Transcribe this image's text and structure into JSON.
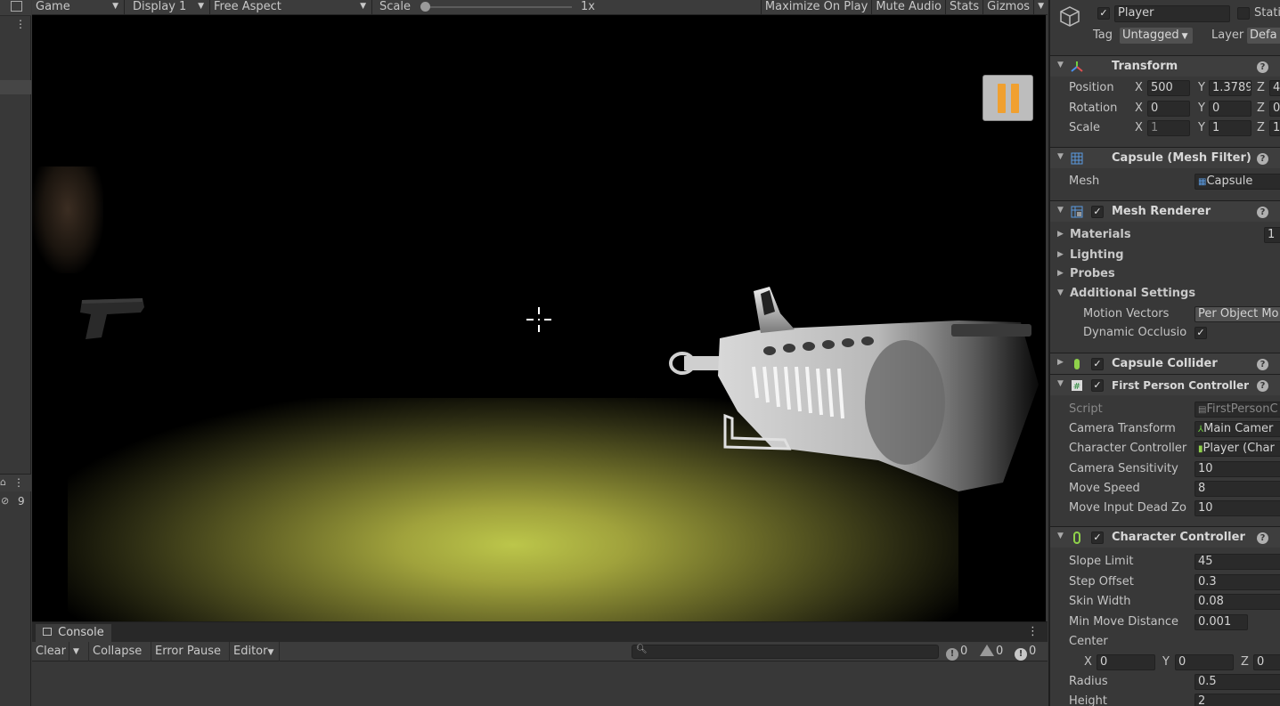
{
  "game_toolbar": {
    "view_label": "Game",
    "display_label": "Display 1",
    "aspect_label": "Free Aspect",
    "scale_label": "Scale",
    "scale_value": "1x",
    "scale_slider_fraction": 0.0,
    "maximize_label": "Maximize On Play",
    "mute_label": "Mute Audio",
    "stats_label": "Stats",
    "gizmos_label": "Gizmos"
  },
  "left_strip": {
    "layer_count": "9"
  },
  "console": {
    "tab_label": "Console",
    "clear_label": "Clear",
    "collapse_label": "Collapse",
    "error_pause_label": "Error Pause",
    "editor_label": "Editor",
    "search_placeholder": "",
    "log_count": "0",
    "warning_count": "0",
    "error_count": "0"
  },
  "inspector": {
    "object_name": "Player",
    "static_label": "Stati",
    "tag_label": "Tag",
    "tag_value": "Untagged",
    "layer_label": "Layer",
    "layer_value": "Defa",
    "transform": {
      "title": "Transform",
      "position_label": "Position",
      "rotation_label": "Rotation",
      "scale_label": "Scale",
      "position": {
        "x": "500",
        "y": "1.3789",
        "z": "4"
      },
      "rotation": {
        "x": "0",
        "y": "0",
        "z": "0"
      },
      "scale": {
        "x": "1",
        "y": "1",
        "z": "1"
      }
    },
    "mesh_filter": {
      "title": "Capsule (Mesh Filter)",
      "mesh_label": "Mesh",
      "mesh_value": "Capsule"
    },
    "mesh_renderer": {
      "title": "Mesh Renderer",
      "materials_label": "Materials",
      "materials_count": "1",
      "lighting_label": "Lighting",
      "probes_label": "Probes",
      "additional_label": "Additional Settings",
      "motion_vectors_label": "Motion Vectors",
      "motion_vectors_value": "Per Object Mo",
      "dynamic_occlusion_label": "Dynamic Occlusio"
    },
    "capsule_collider": {
      "title": "Capsule Collider"
    },
    "fps_controller": {
      "title": "First Person Controller",
      "script_label": "Script",
      "script_value": "FirstPersonC",
      "camera_transform_label": "Camera Transform",
      "camera_transform_value": "Main Camer",
      "character_controller_label": "Character Controller",
      "character_controller_value": "Player (Char",
      "camera_sensitivity_label": "Camera Sensitivity",
      "camera_sensitivity_value": "10",
      "move_speed_label": "Move Speed",
      "move_speed_value": "8",
      "dead_zone_label": "Move Input Dead Zo",
      "dead_zone_value": "10"
    },
    "character_controller": {
      "title": "Character Controller",
      "slope_label": "Slope Limit",
      "slope_value": "45",
      "step_label": "Step Offset",
      "step_value": "0.3",
      "skin_label": "Skin Width",
      "skin_value": "0.08",
      "min_move_label": "Min Move Distance",
      "min_move_value": "0.001",
      "center_label": "Center",
      "center": {
        "x": "0",
        "y": "0",
        "z": "0"
      },
      "radius_label": "Radius",
      "radius_value": "0.5",
      "height_label": "Height",
      "height_value": "2"
    }
  }
}
